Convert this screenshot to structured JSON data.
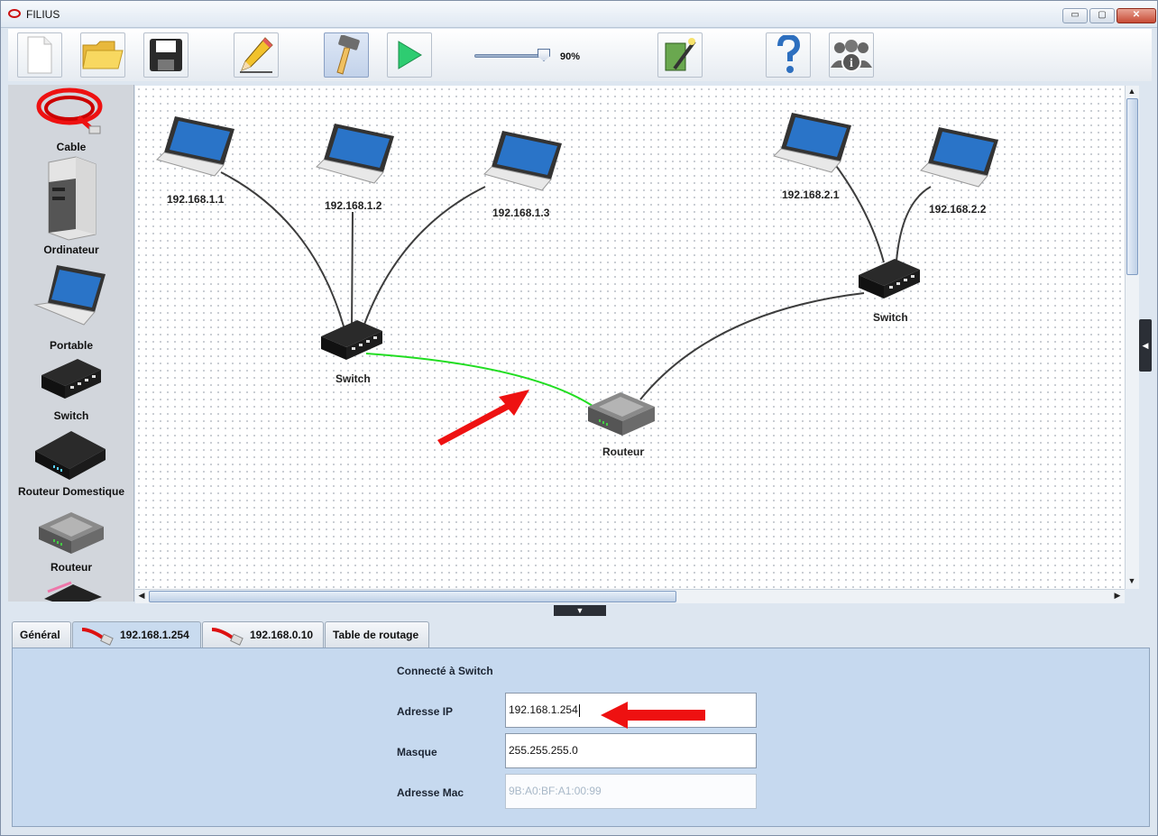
{
  "window": {
    "title": "FILIUS",
    "min_label": "▭",
    "max_label": "▢",
    "close_label": "✕"
  },
  "toolbar": {
    "buttons": [
      {
        "name": "new-file",
        "icon": "new-document-icon"
      },
      {
        "name": "open-file",
        "icon": "folder-icon"
      },
      {
        "name": "save-file",
        "icon": "floppy-disk-icon"
      },
      {
        "name": "design-mode",
        "icon": "pencil-icon"
      },
      {
        "name": "build-mode",
        "icon": "hammer-icon"
      },
      {
        "name": "simulate",
        "icon": "play-icon"
      },
      {
        "name": "wizard",
        "icon": "magic-book-icon"
      },
      {
        "name": "help",
        "icon": "question-mark-icon"
      },
      {
        "name": "about",
        "icon": "info-users-icon"
      }
    ],
    "zoom_percent": 90,
    "zoom_label": "90%"
  },
  "palette": {
    "items": [
      {
        "label": "Cable"
      },
      {
        "label": "Ordinateur"
      },
      {
        "label": "Portable"
      },
      {
        "label": "Switch"
      },
      {
        "label": "Routeur Domestique"
      },
      {
        "label": "Routeur"
      }
    ]
  },
  "canvas": {
    "laptops": [
      {
        "label": "192.168.1.1"
      },
      {
        "label": "192.168.1.2"
      },
      {
        "label": "192.168.1.3"
      },
      {
        "label": "192.168.2.1"
      },
      {
        "label": "192.168.2.2"
      }
    ],
    "switch_left_label": "Switch",
    "switch_right_label": "Switch",
    "router_label": "Routeur",
    "accent_link_color": "#22dd22",
    "annotation_color": "#ee1111"
  },
  "panel": {
    "tabs": [
      {
        "label": "Général"
      },
      {
        "label": "192.168.1.254"
      },
      {
        "label": "192.168.0.10"
      },
      {
        "label": "Table de routage"
      }
    ],
    "active_tab": "192.168.1.254",
    "connected_to": "Connecté à Switch",
    "ip_label": "Adresse IP",
    "ip_value": "192.168.1.254",
    "mask_label": "Masque",
    "mask_value": "255.255.255.0",
    "mac_label": "Adresse Mac",
    "mac_value": "9B:A0:BF:A1:00:99"
  }
}
